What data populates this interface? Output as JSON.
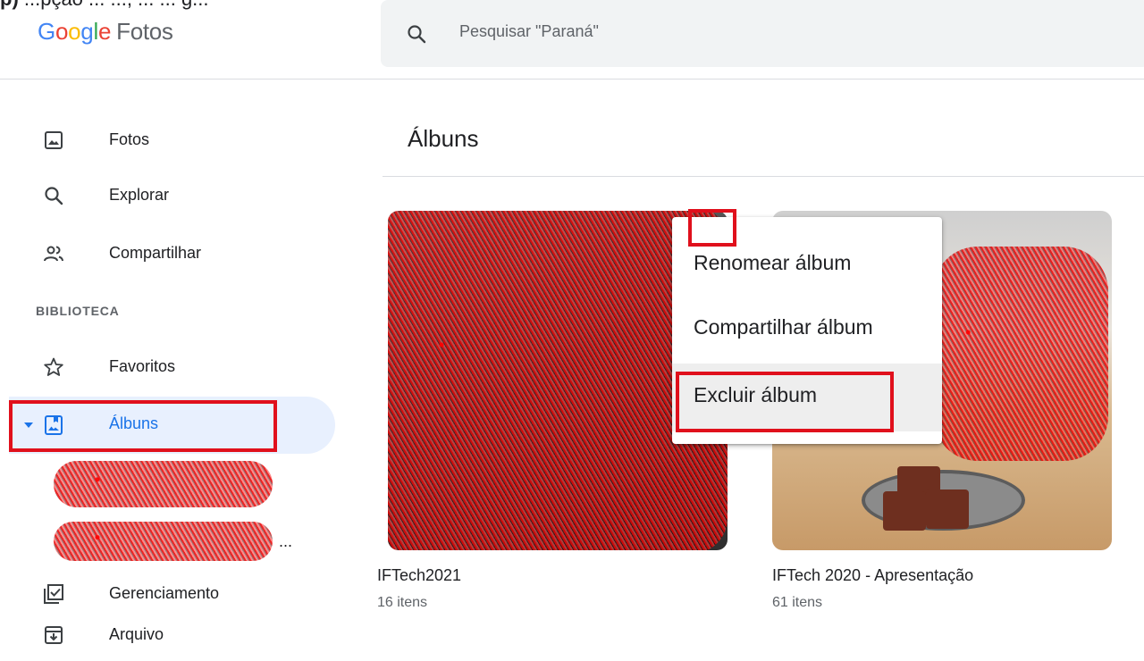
{
  "caption": {
    "bold": "p)",
    "text": " ...pção ... ..., ... ... g..."
  },
  "header": {
    "logo_letters": [
      "G",
      "o",
      "o",
      "g",
      "l",
      "e"
    ],
    "product": "Fotos",
    "search_placeholder": "Pesquisar \"Paraná\""
  },
  "sidebar": {
    "items": [
      {
        "label": "Fotos",
        "icon": "photo-icon"
      },
      {
        "label": "Explorar",
        "icon": "search-icon"
      },
      {
        "label": "Compartilhar",
        "icon": "people-icon"
      },
      {
        "label": "Favoritos",
        "icon": "star-icon"
      },
      {
        "label": "Álbuns",
        "icon": "album-icon"
      },
      {
        "label": "Gerenciamento",
        "icon": "checklist-icon"
      },
      {
        "label": "Arquivo",
        "icon": "archive-icon"
      }
    ],
    "section_label": "BIBLIOTECA",
    "ellipsis": "..."
  },
  "main": {
    "title": "Álbuns",
    "albums": [
      {
        "name": "IFTech2021",
        "count": "16 itens"
      },
      {
        "name": "IFTech 2020 - Apresentação",
        "count": "61 itens"
      }
    ]
  },
  "context_menu": {
    "items": [
      "Renomear álbum",
      "Compartilhar álbum",
      "Excluir álbum"
    ],
    "highlighted": "Excluir álbum"
  },
  "colors": {
    "accent": "#1a73e8",
    "active_bg": "#e8f0fe",
    "annotation_red": "#e0101c"
  }
}
